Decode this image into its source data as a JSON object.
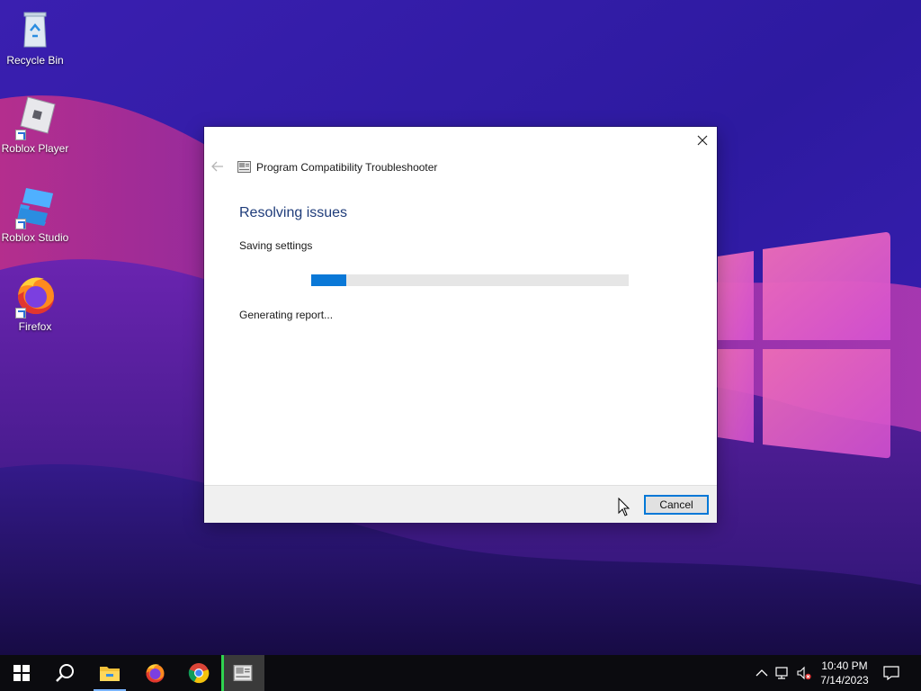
{
  "desktop": {
    "icons": [
      {
        "label": "Recycle Bin"
      },
      {
        "label": "Roblox Player"
      },
      {
        "label": "Roblox Studio"
      },
      {
        "label": "Firefox"
      }
    ]
  },
  "dialog": {
    "title": "Program Compatibility Troubleshooter",
    "heading": "Resolving issues",
    "status": "Saving settings",
    "progress_fraction": 0.11,
    "detail": "Generating report...",
    "cancel_label": "Cancel"
  },
  "taskbar": {
    "items": [
      "start",
      "search",
      "file-explorer",
      "firefox",
      "chrome",
      "troubleshooter"
    ],
    "clock_time": "10:40 PM",
    "clock_date": "7/14/2023"
  },
  "colors": {
    "accent": "#0078d7",
    "heading": "#1f3c7a",
    "progress": "#0a78d7"
  }
}
